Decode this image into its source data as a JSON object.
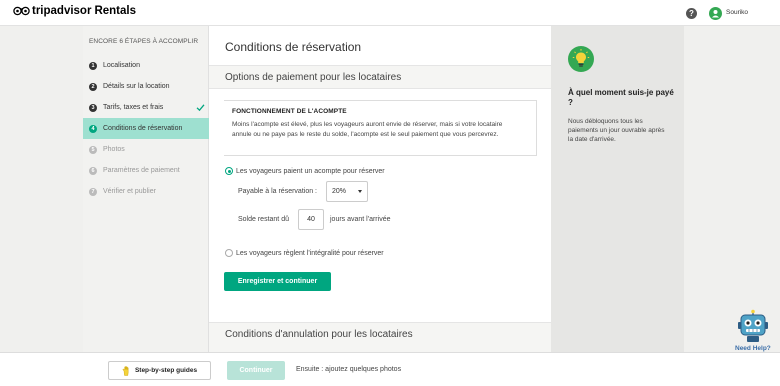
{
  "header": {
    "brand": "tripadvisor",
    "brand_suffix": "Rentals",
    "help_label": "?",
    "user_name": "Souriko"
  },
  "sidebar": {
    "heading": "ENCORE 6 ÉTAPES À ACCOMPLIR",
    "steps": [
      {
        "num": "1",
        "label": "Localisation",
        "state": "done"
      },
      {
        "num": "2",
        "label": "Détails sur la location",
        "state": "done"
      },
      {
        "num": "3",
        "label": "Tarifs, taxes et frais",
        "state": "completed"
      },
      {
        "num": "4",
        "label": "Conditions de réservation",
        "state": "active"
      },
      {
        "num": "5",
        "label": "Photos",
        "state": "pending"
      },
      {
        "num": "6",
        "label": "Paramètres de paiement",
        "state": "pending"
      },
      {
        "num": "7",
        "label": "Vérifier et publier",
        "state": "pending"
      }
    ]
  },
  "main": {
    "title": "Conditions de réservation",
    "payment_section_title": "Options de paiement pour les locataires",
    "info_box": {
      "title": "FONCTIONNEMENT DE L'ACOMPTE",
      "text": "Moins l'acompte est élevé, plus les voyageurs auront envie de réserver, mais si votre locataire annule ou ne paye pas le reste du solde, l'acompte est le seul paiement que vous percevrez."
    },
    "option_deposit_label": "Les voyageurs paient un acompte pour réserver",
    "payable_label": "Payable à la réservation :",
    "payable_value": "20%",
    "balance_label": "Solde restant dû",
    "balance_days": "40",
    "balance_suffix": "jours avant l'arrivée",
    "option_full_label": "Les voyageurs règlent l'intégralité pour réserver",
    "save_button": "Enregistrer et continuer",
    "cancellation_section_title": "Conditions d'annulation pour les locataires"
  },
  "tip": {
    "title": "À quel moment suis-je payé ?",
    "text": "Nous débloquons tous les paiements un jour ouvrable après la date d'arrivée."
  },
  "help_bot": {
    "label": "Need Help?"
  },
  "footer": {
    "guide_button": "Step-by-step guides",
    "continue_button": "Continuer",
    "next_text": "Ensuite : ajoutez quelques photos"
  },
  "colors": {
    "accent": "#00a680",
    "active_step_bg": "#9ee0d0",
    "continue_disabled": "#b8e3d8",
    "tip_icon_bg": "#34a853",
    "need_help": "#3b6ea8"
  }
}
